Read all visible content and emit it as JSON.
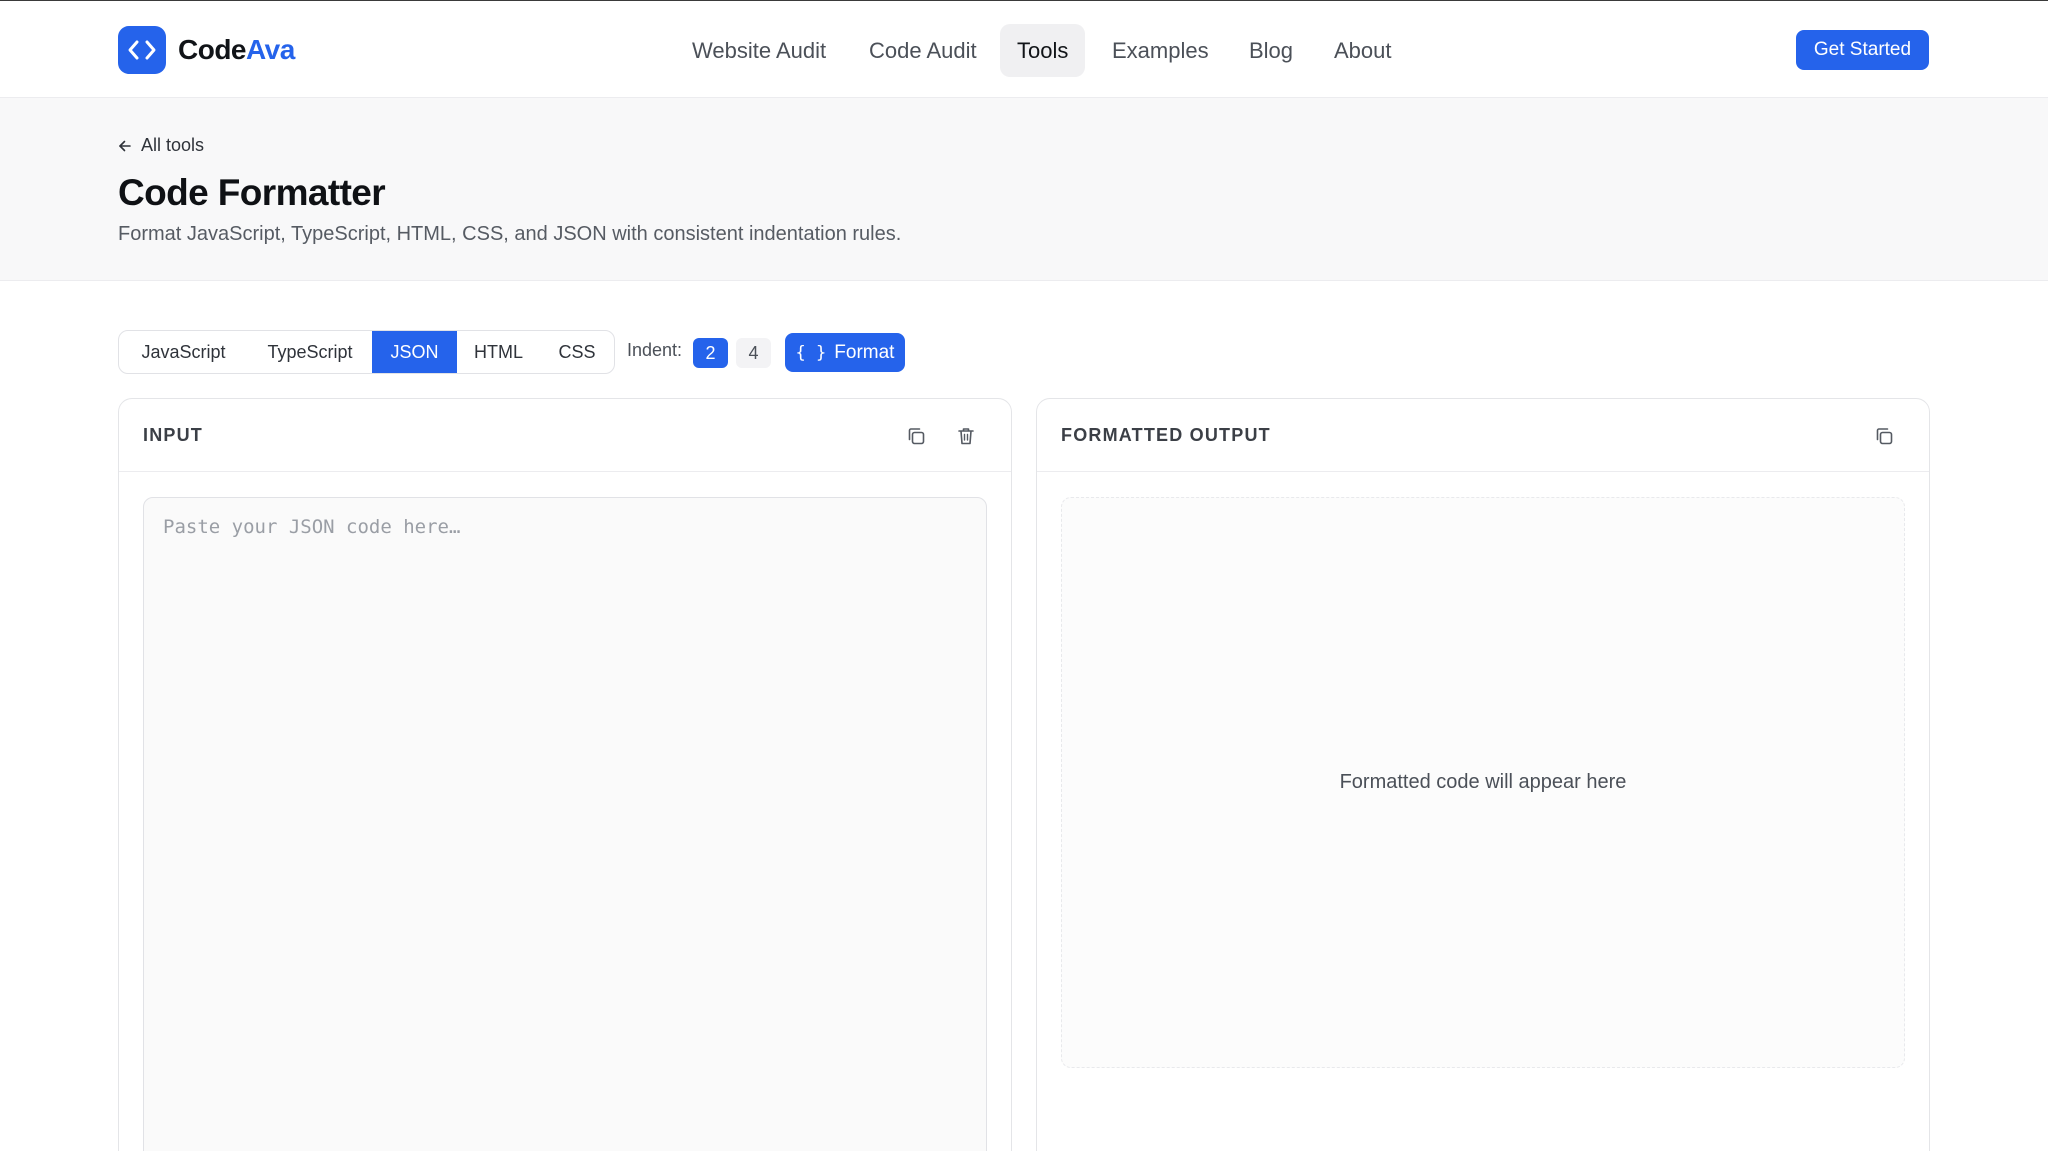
{
  "brand": {
    "name_part1": "Code",
    "name_part2": "Ava",
    "accent": "#2563eb"
  },
  "nav": {
    "items": [
      {
        "label": "Website Audit",
        "active": false
      },
      {
        "label": "Code Audit",
        "active": false
      },
      {
        "label": "Tools",
        "active": true
      },
      {
        "label": "Examples",
        "active": false
      },
      {
        "label": "Blog",
        "active": false
      },
      {
        "label": "About",
        "active": false
      }
    ],
    "cta": "Get Started"
  },
  "hero": {
    "back_label": "All tools",
    "title": "Code Formatter",
    "subtitle": "Format JavaScript, TypeScript, HTML, CSS, and JSON with consistent indentation rules."
  },
  "toolbar": {
    "languages": [
      "JavaScript",
      "TypeScript",
      "JSON",
      "HTML",
      "CSS"
    ],
    "selected_language": "JSON",
    "indent_label": "Indent:",
    "indent_options": [
      "2",
      "4"
    ],
    "selected_indent": "2",
    "format_icon": "{ }",
    "format_label": "Format"
  },
  "input_panel": {
    "title": "INPUT",
    "placeholder": "Paste your JSON code here…",
    "icons": [
      "copy-icon",
      "trash-icon"
    ]
  },
  "output_panel": {
    "title": "FORMATTED OUTPUT",
    "placeholder": "Formatted code will appear here",
    "icons": [
      "copy-icon"
    ]
  }
}
